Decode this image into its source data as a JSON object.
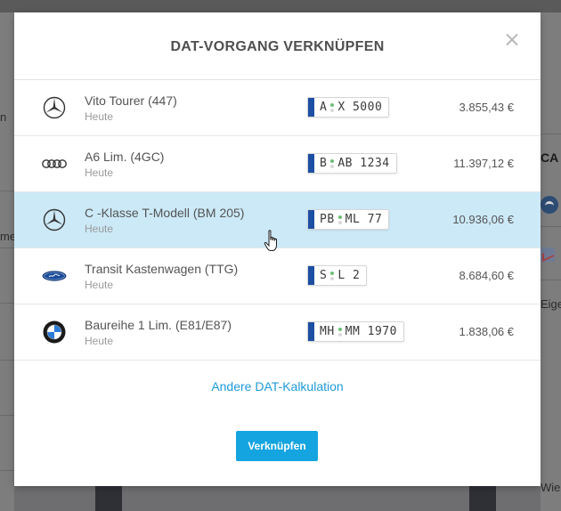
{
  "modal": {
    "title": "DAT-VORGANG VERKNÜPFEN",
    "close_label": "×",
    "alternate_link": "Andere DAT-Kalkulation",
    "confirm_button": "Verknüpfen"
  },
  "rows": [
    {
      "brand_icon": "mercedes-logo-icon",
      "model": "Vito Tourer (447)",
      "date": "Heute",
      "plate": {
        "left": "A",
        "right": "X 5000"
      },
      "price": "3.855,43 €",
      "selected": false
    },
    {
      "brand_icon": "audi-logo-icon",
      "model": "A6 Lim. (4GC)",
      "date": "Heute",
      "plate": {
        "left": "B",
        "right": "AB 1234"
      },
      "price": "11.397,12 €",
      "selected": false
    },
    {
      "brand_icon": "mercedes-logo-icon",
      "model": "C -Klasse T-Modell (BM 205)",
      "date": "Heute",
      "plate": {
        "left": "PB",
        "right": "ML 77"
      },
      "price": "10.936,06 €",
      "selected": true
    },
    {
      "brand_icon": "ford-logo-icon",
      "model": "Transit Kastenwagen (TTG)",
      "date": "Heute",
      "plate": {
        "left": "S",
        "right": "L 2"
      },
      "price": "8.684,60 €",
      "selected": false
    },
    {
      "brand_icon": "bmw-logo-icon",
      "model": "Baureihe 1 Lim. (E81/E87)",
      "date": "Heute",
      "plate": {
        "left": "MH",
        "right": "MM 1970"
      },
      "price": "1.838,06 €",
      "selected": false
    }
  ],
  "background": {
    "left_fragments": [
      "n",
      "me"
    ],
    "right_fragments": [
      "CA",
      "Eige",
      "Wie"
    ]
  },
  "colors": {
    "accent": "#14a4e0",
    "link": "#1f9ad8",
    "selected_row": "#cce9f7",
    "plate_eu_band": "#1d4fa3"
  }
}
